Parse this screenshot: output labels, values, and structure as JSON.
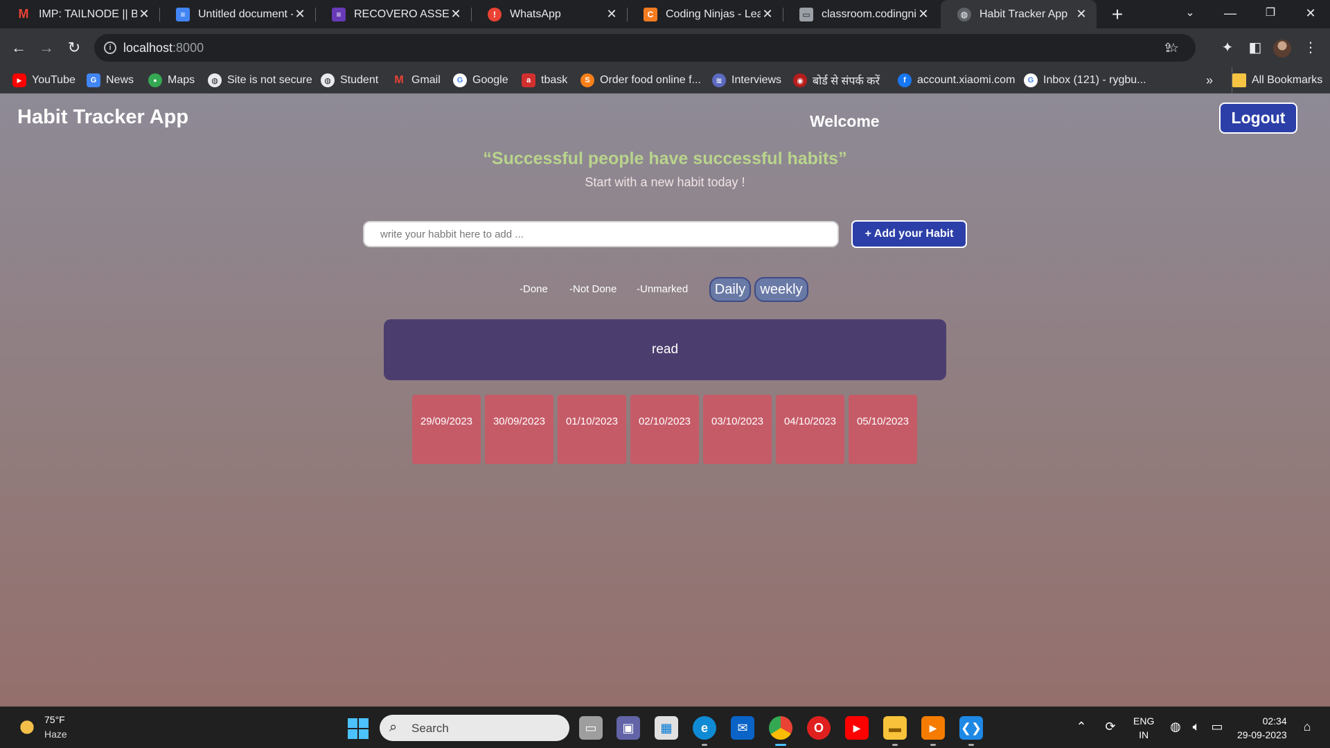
{
  "browser": {
    "tabs": [
      {
        "title": "IMP: TAILNODE || BAC",
        "icon": "gmail-icon",
        "color": "#ea4335",
        "letter": "M"
      },
      {
        "title": "Untitled document -",
        "icon": "docs-icon",
        "color": "#4285f4",
        "letter": "≡"
      },
      {
        "title": "RECOVERO ASSESSM",
        "icon": "forms-icon",
        "color": "#673ab7",
        "letter": "≡"
      },
      {
        "title": "WhatsApp",
        "icon": "whatsapp-alert-icon",
        "color": "#ea4335",
        "letter": "!"
      },
      {
        "title": "Coding Ninjas - Learn",
        "icon": "coding-ninjas-icon",
        "color": "#f47c20",
        "letter": "C"
      },
      {
        "title": "classroom.codingninj",
        "icon": "classroom-icon",
        "color": "#9aa0a6",
        "letter": "▭"
      },
      {
        "title": "Habit Tracker App",
        "icon": "globe-icon",
        "color": "#5f6368",
        "letter": "◍"
      }
    ],
    "url": "localhost",
    "url_port": ":8000",
    "bookmarks": [
      {
        "label": "YouTube",
        "icon": "youtube-icon",
        "color": "#ff0000",
        "letter": "▶"
      },
      {
        "label": "News",
        "icon": "google-news-icon",
        "color": "#4285f4",
        "letter": "G"
      },
      {
        "label": "Maps",
        "icon": "maps-icon",
        "color": "#34a853",
        "letter": "⬤"
      },
      {
        "label": "Site is not secure",
        "icon": "globe-icon",
        "color": "#5f6368",
        "letter": "◍"
      },
      {
        "label": "Student",
        "icon": "globe-icon",
        "color": "#5f6368",
        "letter": "◍"
      },
      {
        "label": "Gmail",
        "icon": "gmail-icon",
        "color": "#ea4335",
        "letter": "M"
      },
      {
        "label": "Google",
        "icon": "google-icon",
        "color": "#4285f4",
        "letter": "G"
      },
      {
        "label": "tbask",
        "icon": "tbask-icon",
        "color": "#d32f2f",
        "letter": "a"
      },
      {
        "label": "Order food online f...",
        "icon": "swiggy-icon",
        "color": "#fc8019",
        "letter": "S"
      },
      {
        "label": "Interviews",
        "icon": "interviews-icon",
        "color": "#5c6bc0",
        "letter": "≋"
      },
      {
        "label": "बोर्ड से संपर्क करें",
        "icon": "board-icon",
        "color": "#b71c1c",
        "letter": "◉"
      },
      {
        "label": "account.xiaomi.com",
        "icon": "facebook-icon",
        "color": "#1877f2",
        "letter": "f"
      },
      {
        "label": "Inbox (121) - rygbu...",
        "icon": "google-icon",
        "color": "#4285f4",
        "letter": "G"
      }
    ],
    "all_bookmarks": "All Bookmarks",
    "overflow": "»"
  },
  "app": {
    "title": "Habit Tracker App",
    "welcome": "Welcome",
    "logout": "Logout",
    "quote": "“Successful people have successful habits”",
    "subquote": "Start with a new habit today !",
    "input_placeholder": "write your habbit here to add ...",
    "add_button": "+ Add your Habit",
    "legend": {
      "done": "-Done",
      "not_done": "-Not Done",
      "unmarked": "-Unmarked"
    },
    "view_toggle": {
      "daily": "Daily",
      "weekly": "weekly"
    },
    "habit": "read",
    "dates": [
      "29/09/2023",
      "30/09/2023",
      "01/10/2023",
      "02/10/2023",
      "03/10/2023",
      "04/10/2023",
      "05/10/2023"
    ],
    "colors": {
      "accent": "#2c3fa8",
      "habit_card": "#4b3e6e",
      "unmarked_day": "#c65b68",
      "quote": "#b9d48c"
    }
  },
  "taskbar": {
    "temperature": "75°F",
    "condition": "Haze",
    "search": "Search",
    "lang_top": "ENG",
    "lang_bottom": "IN",
    "time": "02:34",
    "date": "29-09-2023"
  }
}
